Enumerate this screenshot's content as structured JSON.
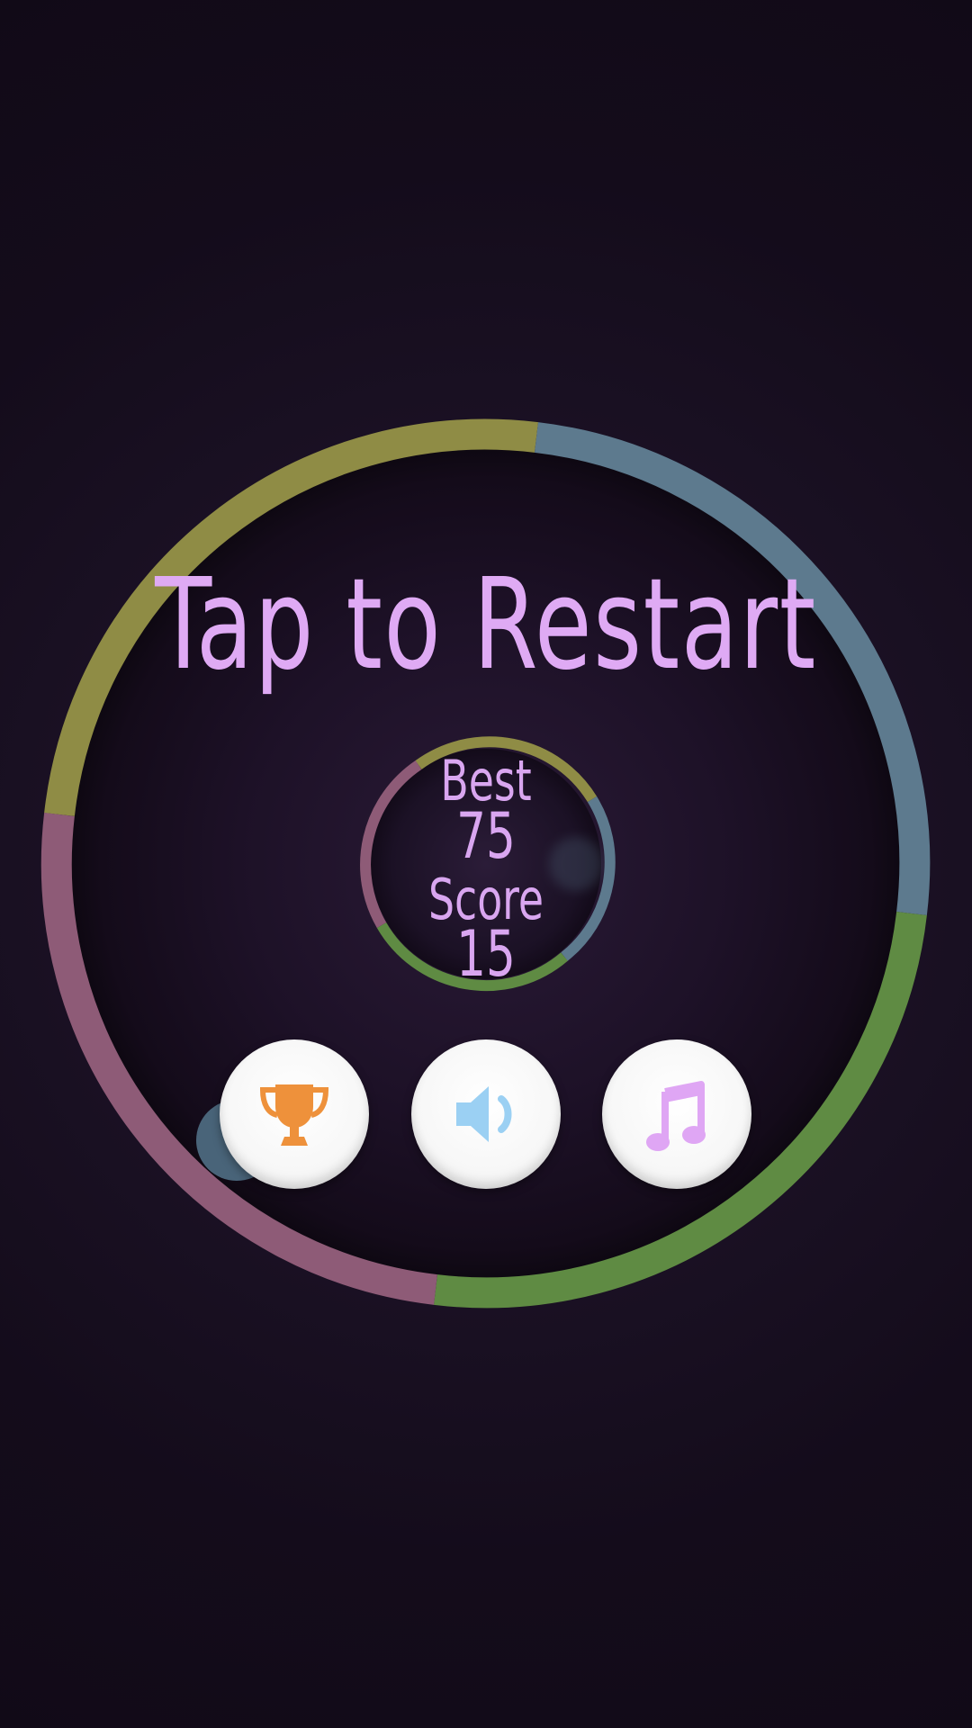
{
  "title": "Tap to Restart",
  "stats": {
    "best_label": "Best",
    "best_value": "75",
    "score_label": "Score",
    "score_value": "15"
  },
  "buttons": [
    {
      "id": "leaderboard",
      "icon": "trophy-icon",
      "color": "#ee913b"
    },
    {
      "id": "sound",
      "icon": "speaker-icon",
      "color": "#9bd0f3"
    },
    {
      "id": "music",
      "icon": "music-note-icon",
      "color": "#dfa6f4"
    }
  ],
  "colors": {
    "background": "#150d1c",
    "text": "#dfaaf4",
    "ring_yellow": "#8f8c45",
    "ring_blue": "#5d7a8e",
    "ring_green": "#5f8b43",
    "ring_pink": "#8e5b77",
    "player_ball": "#496479"
  }
}
